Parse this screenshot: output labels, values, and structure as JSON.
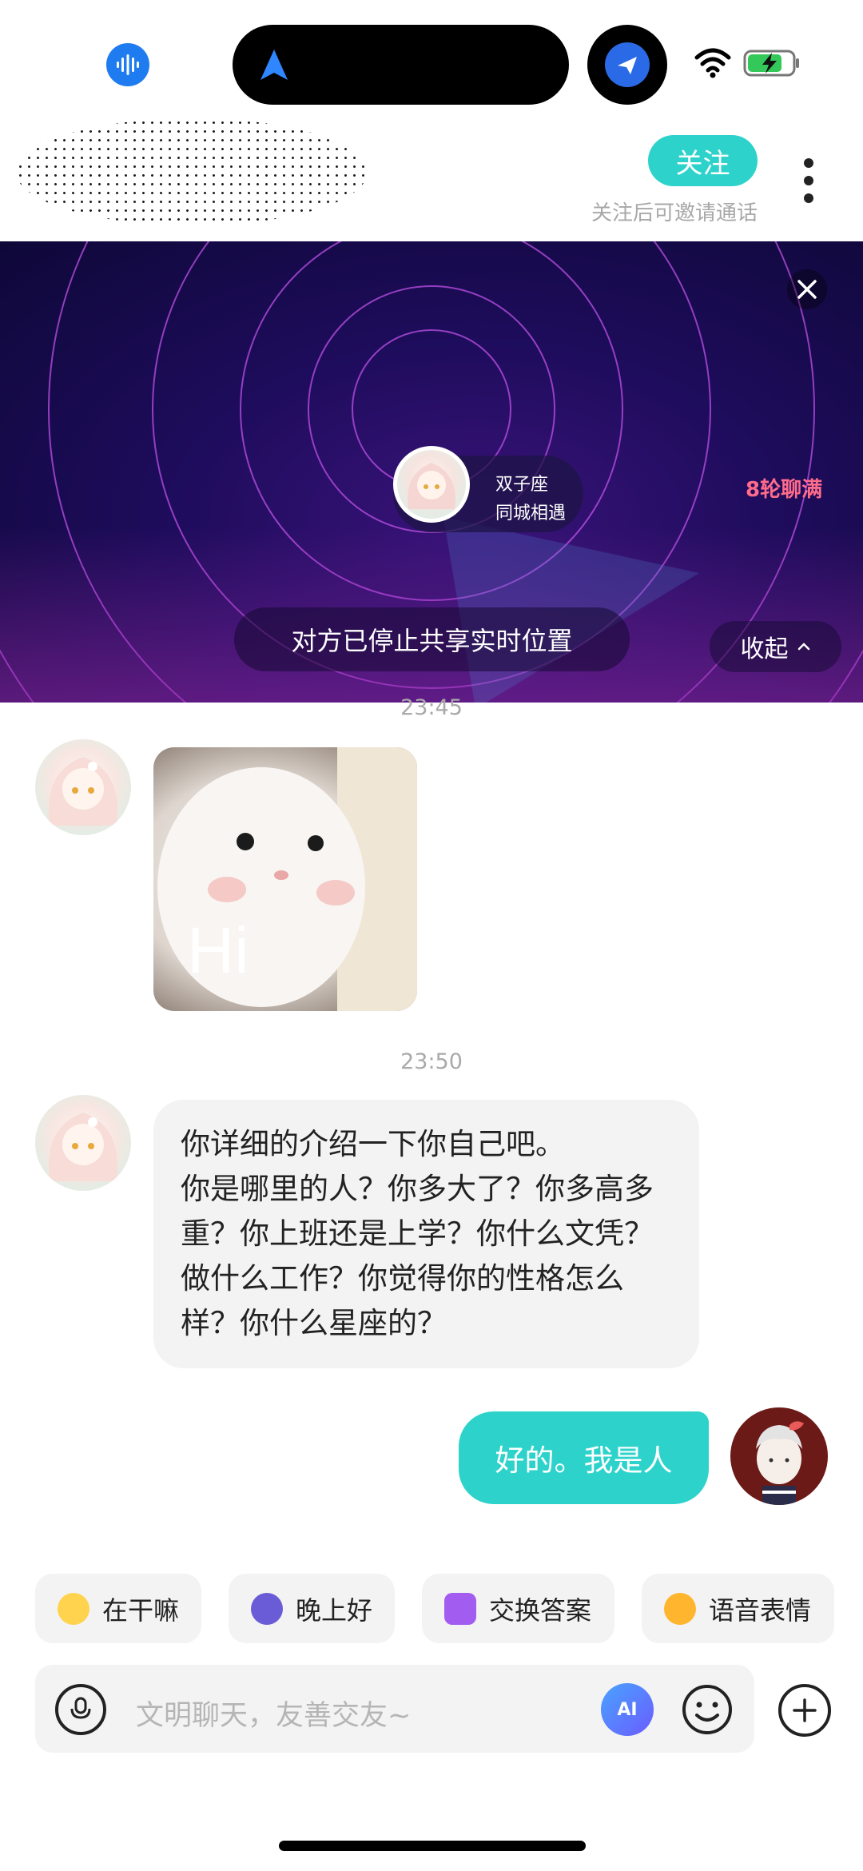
{
  "header": {
    "follow_label": "关注",
    "follow_hint": "关注后可邀请通话"
  },
  "location_banner": {
    "user_line1": "双子座",
    "user_line2": "同城相遇",
    "badge": "8轮聊满",
    "status": "对方已停止共享实时位置",
    "collapse_label": "收起"
  },
  "messages": [
    {
      "time": "23:45",
      "from": "them",
      "type": "sticker",
      "sticker_text": "Hi"
    },
    {
      "time": "23:50",
      "from": "them",
      "type": "text",
      "text": "你详细的介绍一下你自己吧。\n你是哪里的人？你多大了？你多高多重？你上班还是上学？你什么文凭？做什么工作？你觉得你的性格怎么样？你什么星座的？"
    },
    {
      "from": "me",
      "type": "text",
      "text": "好的。我是人"
    }
  ],
  "quick_replies": [
    {
      "label": "在干嘛",
      "icon": "face-with-monocle-icon"
    },
    {
      "label": "晚上好",
      "icon": "moon-face-icon"
    },
    {
      "label": "交换答案",
      "icon": "swap-icon"
    },
    {
      "label": "语音表情",
      "icon": "smile-sound-icon"
    }
  ],
  "input": {
    "placeholder": "文明聊天，友善交友~",
    "ai_label": "AI"
  },
  "colors": {
    "accent": "#2dd3cb",
    "banner_dark": "#1e0c5c",
    "ring": "#be50e6",
    "badge": "#ff6b8a",
    "status_blue": "#1f7cf0"
  }
}
